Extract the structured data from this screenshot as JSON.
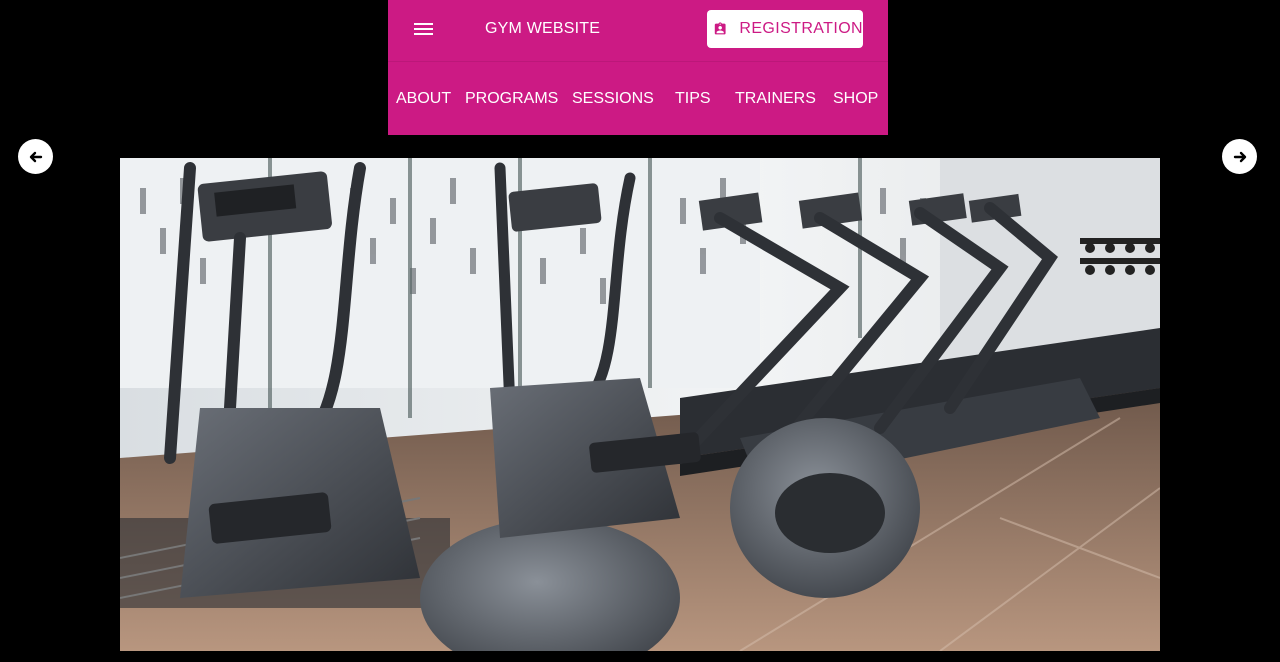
{
  "header": {
    "title": "GYM WEBSITE",
    "menu_icon": "hamburger-menu-icon",
    "registration": {
      "label": "REGISTRATION",
      "icon": "badge-icon"
    },
    "bg_color": "#cc1a84"
  },
  "nav": {
    "items": [
      {
        "label": "ABOUT"
      },
      {
        "label": "PROGRAMS"
      },
      {
        "label": "SESSIONS"
      },
      {
        "label": "TIPS"
      },
      {
        "label": "TRAINERS"
      },
      {
        "label": "SHOP"
      }
    ]
  },
  "slider": {
    "prev_icon": "arrow-left-icon",
    "next_icon": "arrow-right-icon",
    "image": "gym-equipment-photo"
  }
}
